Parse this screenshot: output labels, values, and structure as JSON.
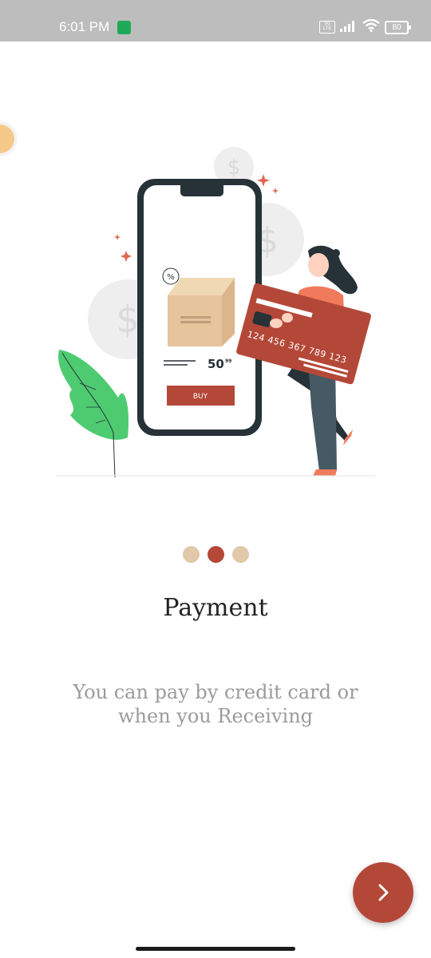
{
  "status_bar": {
    "time": "6:01 PM",
    "volte": "Vo LTE",
    "battery": "80",
    "icons": [
      "app-notification-icon",
      "volte-icon",
      "signal-icon",
      "wifi-icon",
      "battery-icon"
    ]
  },
  "illustration": {
    "discount_symbol": "%",
    "price_main": "50",
    "price_cents": "99",
    "buy_label": "BUY",
    "card_number": "124 456 367 789 123"
  },
  "pager": {
    "total": 3,
    "active_index": 1
  },
  "onboarding": {
    "title": "Payment",
    "description": "You can pay by credit card or when you Receiving"
  },
  "next_button": {
    "icon": "chevron-right-icon"
  },
  "colors": {
    "accent": "#b44838",
    "dot_inactive": "#e0c8a8",
    "status_bar": "#bdbdbd",
    "title": "#222222",
    "description": "#9b9b9b"
  }
}
